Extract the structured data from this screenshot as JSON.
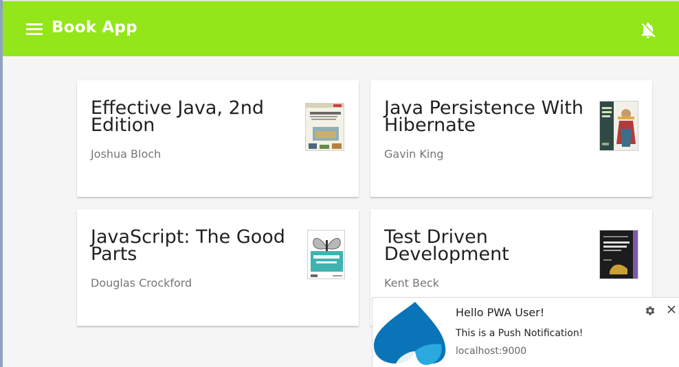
{
  "app": {
    "title": "Book App",
    "brand_color": "#93e619"
  },
  "header": {
    "menu_icon": "menu-icon",
    "notification_icon": "notifications-off-icon"
  },
  "books": [
    {
      "title": "Effective Java, 2nd Edition",
      "author": "Joshua Bloch"
    },
    {
      "title": "Java Persistence With Hibernate",
      "author": "Gavin King"
    },
    {
      "title": "JavaScript: The Good Parts",
      "author": "Douglas Crockford"
    },
    {
      "title": "Test Driven Development",
      "author": "Kent Beck"
    }
  ],
  "notification": {
    "title": "Hello PWA User!",
    "body": "This is a Push Notification!",
    "origin": "localhost:9000",
    "settings_icon": "gear-icon",
    "close_icon": "close-icon"
  }
}
